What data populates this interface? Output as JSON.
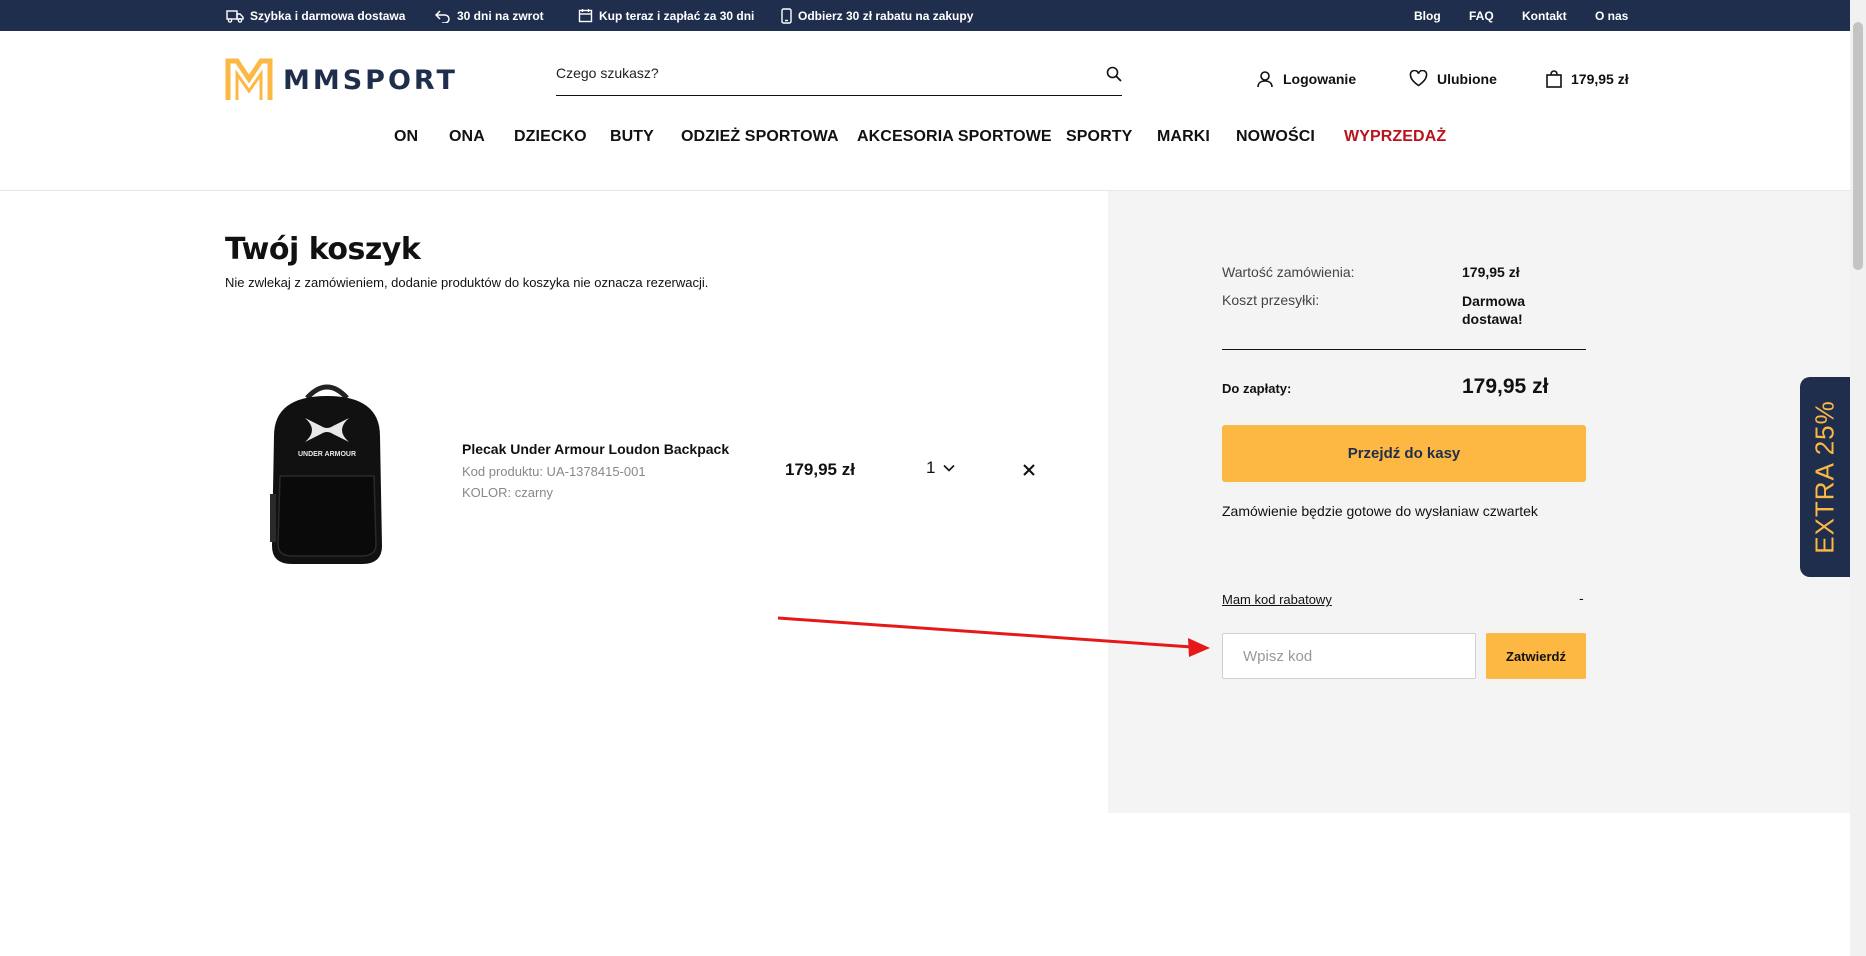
{
  "topbar": {
    "promos": [
      {
        "icon": "truck-icon",
        "label": "Szybka i darmowa dostawa"
      },
      {
        "icon": "return-arrow-icon",
        "label": "30 dni na zwrot"
      },
      {
        "icon": "calendar-icon",
        "label": "Kup teraz i zapłać za 30 dni"
      },
      {
        "icon": "phone-icon",
        "label": "Odbierz 30 zł rabatu na zakupy"
      }
    ],
    "links": [
      "Blog",
      "FAQ",
      "Kontakt",
      "O nas"
    ]
  },
  "header": {
    "logo_text": "MMSPORT",
    "search_placeholder": "Czego szukasz?",
    "login_label": "Logowanie",
    "favorites_label": "Ulubione",
    "cart_total": "179,95 zł"
  },
  "nav": [
    "ON",
    "ONA",
    "DZIECKO",
    "BUTY",
    "ODZIEŻ SPORTOWA",
    "AKCESORIA SPORTOWE",
    "SPORTY",
    "MARKI",
    "NOWOŚCI",
    "WYPRZEDAŻ"
  ],
  "cart": {
    "title": "Twój koszyk",
    "note": "Nie zwlekaj z zamówieniem, dodanie produktów do koszyka nie oznacza rezerwacji.",
    "item": {
      "name": "Plecak Under Armour Loudon Backpack",
      "code": "Kod produktu: UA-1378415-001",
      "color": "KOLOR: czarny",
      "price": "179,95 zł",
      "quantity": "1",
      "brand_print": "UNDER ARMOUR"
    }
  },
  "summary": {
    "order_value_label": "Wartość zamówienia:",
    "order_value": "179,95 zł",
    "shipping_label": "Koszt przesyłki:",
    "shipping_value_line1": "Darmowa",
    "shipping_value_line2": "dostawa!",
    "to_pay_label": "Do zapłaty:",
    "to_pay_value": "179,95 zł",
    "checkout_button": "Przejdź do kasy",
    "ready_note": "Zamówienie będzie gotowe do wysłaniaw czwartek",
    "coupon_link": "Mam kod rabatowy",
    "coupon_dash": "-",
    "coupon_placeholder": "Wpisz kod",
    "coupon_button": "Zatwierdź"
  },
  "extra_tab": "EXTRA 25%",
  "colors": {
    "navy": "#1f2e4d",
    "accent": "#fdb843",
    "sale": "#b8141c",
    "annotation_arrow": "#e61919"
  }
}
